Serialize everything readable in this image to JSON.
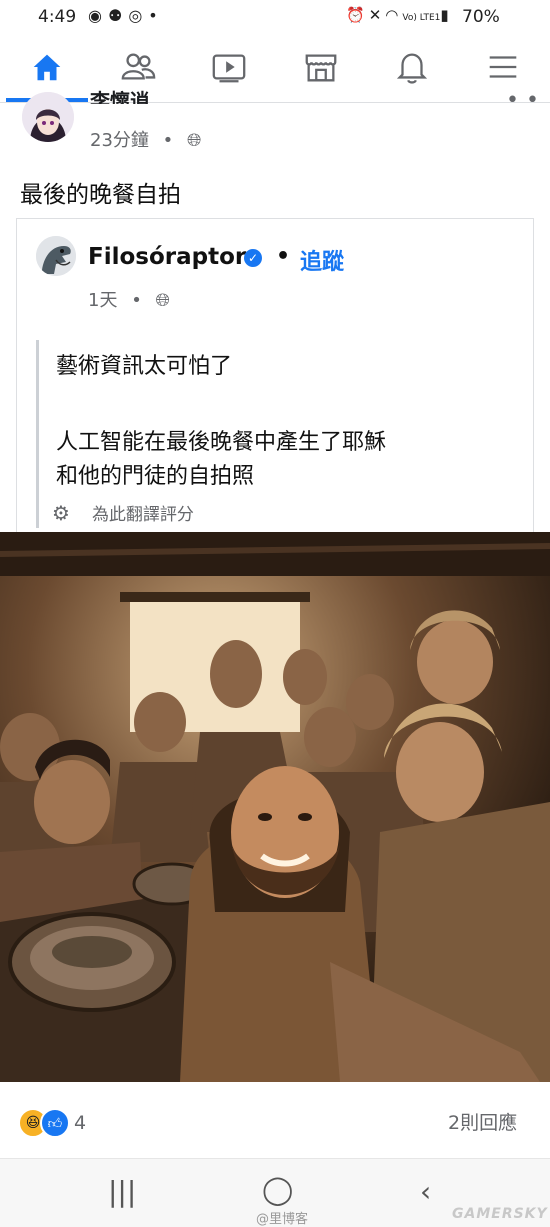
{
  "status_bar": {
    "time": "4:49",
    "left_icons": [
      "messenger-icon",
      "group-icon",
      "sync-icon",
      "dot-icon"
    ],
    "right_icons": [
      "alarm-icon",
      "mute-icon",
      "wifi-icon",
      "lte-icon",
      "signal-icon"
    ],
    "network": "Vo) LTE1",
    "battery": "70%"
  },
  "top_nav": {
    "items": [
      "home-icon",
      "friends-icon",
      "watch-icon",
      "marketplace-icon",
      "notifications-icon",
      "menu-icon"
    ],
    "active_index": 0,
    "accent": "#1877f2"
  },
  "post": {
    "author": "李懷逍",
    "time": "23分鐘",
    "dot": "•",
    "text": "最後的晚餐自拍"
  },
  "shared": {
    "author": "Filosóraptor",
    "dot": "•",
    "follow": "追蹤",
    "time": "1天",
    "lines": [
      "藝術資訊太可怕了",
      "人工智能在最後晚餐中產生了耶穌",
      "和他的門徒的自拍照"
    ],
    "translate": "為此翻譯評分"
  },
  "footer": {
    "reaction_count": "4",
    "comments": "2則回應"
  },
  "watermarks": {
    "left": "@里博客",
    "right": "GAMERSKY"
  }
}
